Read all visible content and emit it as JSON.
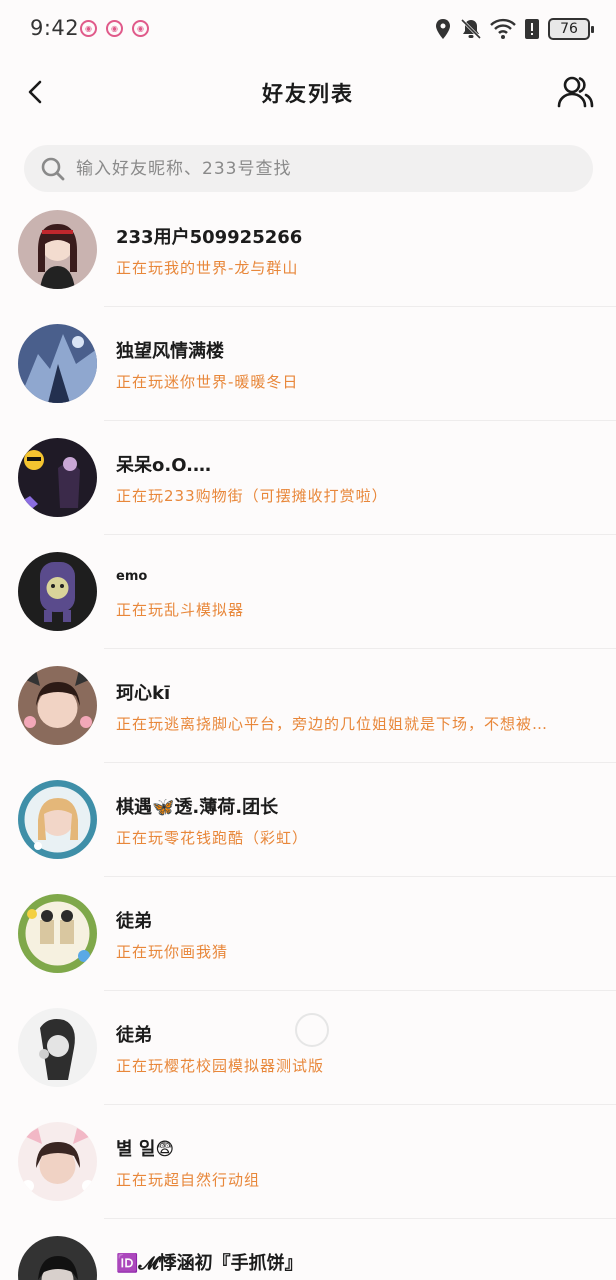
{
  "status_bar": {
    "time": "9:42",
    "battery": "76",
    "notification_icons": [
      "pig-icon",
      "pig-icon",
      "pig-icon"
    ]
  },
  "header": {
    "title": "好友列表"
  },
  "search": {
    "placeholder": "输入好友昵称、233号查找"
  },
  "friends": [
    {
      "name": "233用户509925266",
      "status": "正在玩我的世界-龙与群山",
      "avatar_color": "#c9b3b0"
    },
    {
      "name": "独望风情满楼",
      "status": "正在玩迷你世界-暖暖冬日",
      "avatar_color": "#4a5f8c"
    },
    {
      "name": "呆呆o.O.…",
      "status": "正在玩233购物街（可摆摊收打赏啦）",
      "avatar_color": "#1f1a26"
    },
    {
      "name": "emo",
      "status": "正在玩乱斗模拟器",
      "avatar_color": "#2b2b2b"
    },
    {
      "name": "珂心kī",
      "status": "正在玩逃离挠脚心平台，旁边的几位姐姐就是下场，不想被…",
      "avatar_color": "#8a6b5c"
    },
    {
      "name": "棋遇🦋透.薄荷.团长",
      "status": "正在玩零花钱跑酷（彩虹）",
      "avatar_color": "#3f8fa8"
    },
    {
      "name": "徒弟",
      "status": "正在玩你画我猜",
      "avatar_color": "#7fa84a"
    },
    {
      "name": "徒弟",
      "status": "正在玩樱花校园模拟器测试版",
      "avatar_color": "#d0d0d0"
    },
    {
      "name": "별 일😨",
      "status": "正在玩超自然行动组",
      "avatar_color": "#e8c9c9"
    },
    {
      "name": "🆔𝓜悸涵初『手抓饼』",
      "status": "",
      "avatar_color": "#333333"
    }
  ],
  "colors": {
    "accent_status": "#e8873a",
    "background": "#fdfbfb",
    "search_bg": "#f1f0f0"
  }
}
